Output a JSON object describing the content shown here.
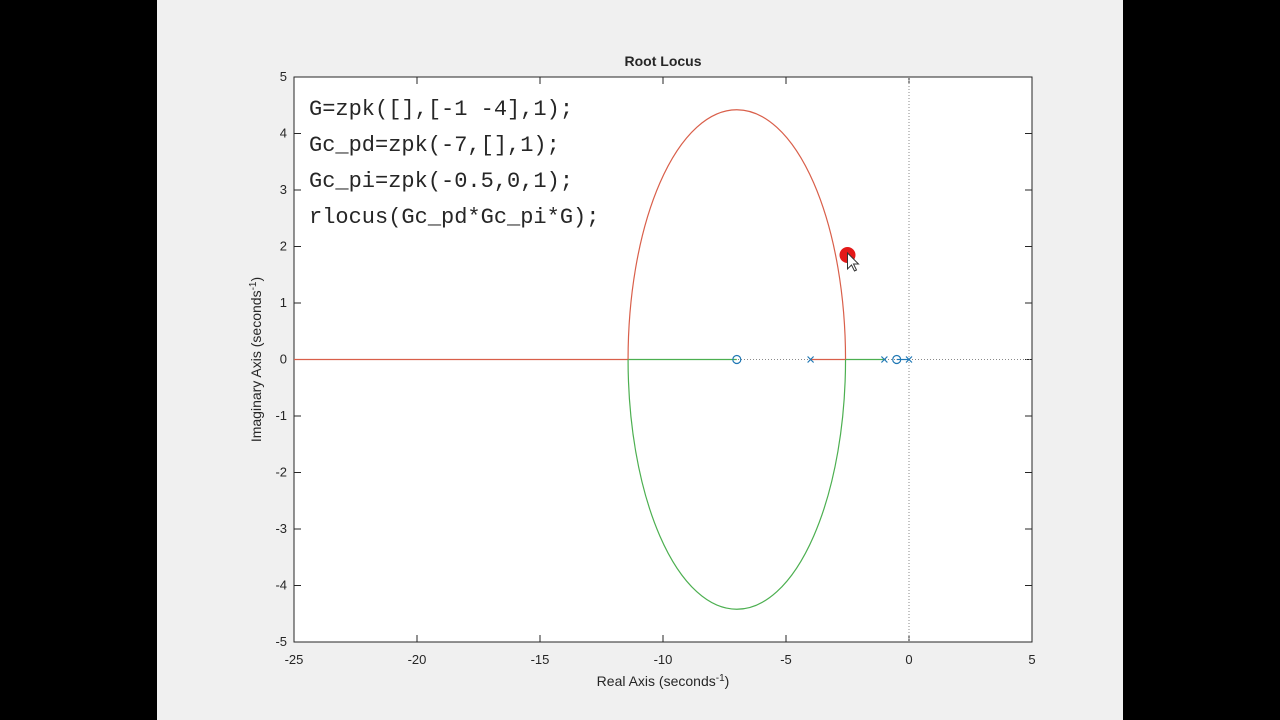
{
  "chart_data": {
    "type": "line",
    "title": "Root Locus",
    "xlabel_main": "Real Axis (seconds",
    "xlabel_sup": "-1",
    "xlabel_end": ")",
    "ylabel_main": "Imaginary Axis (seconds",
    "ylabel_sup": "-1",
    "ylabel_end": ")",
    "xlim": [
      -25,
      5
    ],
    "ylim": [
      -5,
      5
    ],
    "xticks": [
      -25,
      -20,
      -15,
      -10,
      -5,
      0,
      5
    ],
    "yticks": [
      -5,
      -4,
      -3,
      -2,
      -1,
      0,
      1,
      2,
      3,
      4,
      5
    ],
    "poles": [
      [
        -4,
        0
      ],
      [
        -1,
        0
      ],
      [
        0,
        0
      ]
    ],
    "zeros": [
      [
        -7,
        0
      ],
      [
        -0.5,
        0
      ]
    ],
    "ellipse": {
      "center_real": -7,
      "semi_axis_real": 4.42,
      "semi_axis_imag": 4.42
    },
    "series": [
      {
        "color": "#d95f4a",
        "branch": "upper-ellipse-and-left-real-axis",
        "real_axis_segments": [
          [
            -25,
            -11.4
          ],
          [
            -4,
            -2.6
          ]
        ]
      },
      {
        "color": "#4caf50",
        "branch": "lower-ellipse-and-inner-real-axis",
        "real_axis_segments": [
          [
            -11.4,
            -7
          ],
          [
            -2.6,
            -1
          ]
        ]
      },
      {
        "color": "#1f77b4",
        "branch": "pole-zero-markers",
        "real_axis_segments": [
          [
            -0.5,
            0
          ]
        ]
      }
    ],
    "code_lines": [
      "G=zpk([],[-1 -4],1);",
      "Gc_pd=zpk(-7,[],1);",
      "Gc_pi=zpk(-0.5,0,1);",
      "rlocus(Gc_pd*Gc_pi*G);"
    ],
    "cursor_highlight": [
      -2.5,
      1.85
    ]
  },
  "colors": {
    "background": "#000000",
    "figure": "#f0f0f0",
    "axes": "#ffffff",
    "branch_red": "#d95f4a",
    "branch_green": "#4caf50",
    "markers": "#1f77b4",
    "cursor": "#e00000"
  }
}
